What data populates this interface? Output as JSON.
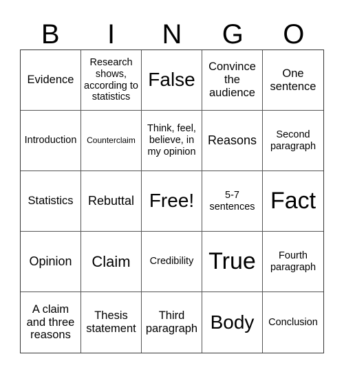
{
  "header": [
    "B",
    "I",
    "N",
    "G",
    "O"
  ],
  "cells": [
    {
      "text": "Evidence",
      "size": "s-md"
    },
    {
      "text": "Research shows, according to statistics",
      "size": "s-sm"
    },
    {
      "text": "False",
      "size": "s-xl"
    },
    {
      "text": "Convince the audience",
      "size": "s-md"
    },
    {
      "text": "One sentence",
      "size": "s-md"
    },
    {
      "text": "Introduction",
      "size": "s-sm"
    },
    {
      "text": "Counterclaim",
      "size": "s-xs"
    },
    {
      "text": "Think, feel, believe, in my opinion",
      "size": "s-sm"
    },
    {
      "text": "Reasons",
      "size": "s-md2"
    },
    {
      "text": "Second paragraph",
      "size": "s-sm"
    },
    {
      "text": "Statistics",
      "size": "s-md"
    },
    {
      "text": "Rebuttal",
      "size": "s-md2"
    },
    {
      "text": "Free!",
      "size": "s-xl"
    },
    {
      "text": "5-7 sentences",
      "size": "s-sm"
    },
    {
      "text": "Fact",
      "size": "s-xxl"
    },
    {
      "text": "Opinion",
      "size": "s-md2"
    },
    {
      "text": "Claim",
      "size": "s-lg"
    },
    {
      "text": "Credibility",
      "size": "s-sm"
    },
    {
      "text": "True",
      "size": "s-xxl"
    },
    {
      "text": "Fourth paragraph",
      "size": "s-sm"
    },
    {
      "text": "A claim and three reasons",
      "size": "s-md"
    },
    {
      "text": "Thesis statement",
      "size": "s-md"
    },
    {
      "text": "Third paragraph",
      "size": "s-md"
    },
    {
      "text": "Body",
      "size": "s-xl"
    },
    {
      "text": "Conclusion",
      "size": "s-sm"
    }
  ]
}
